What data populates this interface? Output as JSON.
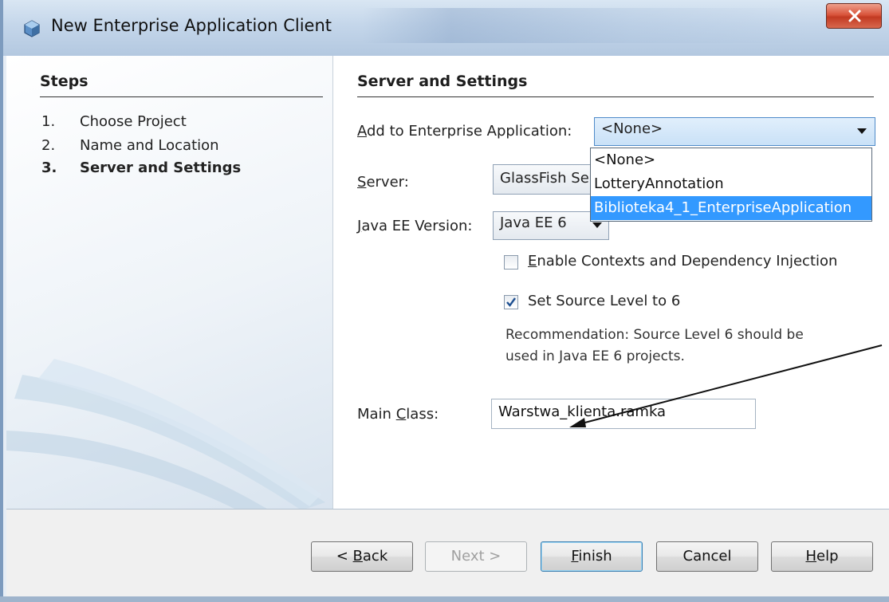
{
  "window": {
    "title": "New Enterprise Application Client",
    "close_label": "x"
  },
  "steps": {
    "heading": "Steps",
    "items": [
      {
        "num": "1.",
        "label": "Choose Project"
      },
      {
        "num": "2.",
        "label": "Name and Location"
      },
      {
        "num": "3.",
        "label": "Server and Settings"
      }
    ],
    "active_index": 2
  },
  "settings": {
    "heading": "Server and Settings",
    "enterprise_app": {
      "label_mnemonic": "A",
      "label_rest": "dd to Enterprise Application:",
      "value": "<None>",
      "options": [
        "<None>",
        "LotteryAnnotation",
        "Biblioteka4_1_EnterpriseApplication"
      ],
      "highlighted_option": "Biblioteka4_1_EnterpriseApplication"
    },
    "server": {
      "label_mnemonic": "S",
      "label_rest": "erver:",
      "value": "GlassFish Se"
    },
    "javaee": {
      "label_mnemonic": "J",
      "label_rest": "ava EE Version:",
      "value": "Java EE 6"
    },
    "cdi_checkbox": {
      "label_mnemonic": "E",
      "label_rest": "nable Contexts and Dependency Injection",
      "checked": false
    },
    "source_level_checkbox": {
      "label": "Set Source Level to 6",
      "checked": true
    },
    "recommendation": {
      "line1": "Recommendation: Source Level 6 should be",
      "line2": "used in Java EE 6 projects."
    },
    "main_class": {
      "label_pre": "Main ",
      "label_mnemonic": "C",
      "label_rest": "lass:",
      "value": "Warstwa_klienta.ramka"
    }
  },
  "buttons": {
    "back": {
      "pre": "< ",
      "mnemonic": "B",
      "rest": "ack"
    },
    "next": "Next >",
    "finish": {
      "mnemonic": "F",
      "rest": "inish"
    },
    "cancel": "Cancel",
    "help": {
      "mnemonic": "H",
      "rest": "elp"
    }
  },
  "colors": {
    "selection": "#3399ff",
    "titlebar": "#c4d6ea",
    "close_button": "#c23a22"
  }
}
